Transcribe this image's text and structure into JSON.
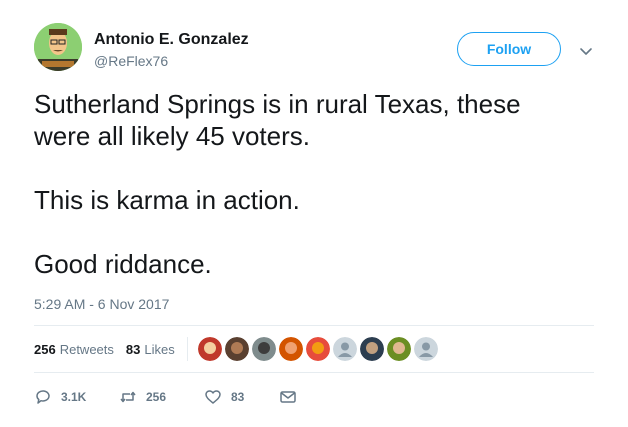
{
  "user": {
    "name": "Antonio E. Gonzalez",
    "handle": "@ReFlex76",
    "avatar_icon": "cartoon-avatar"
  },
  "header": {
    "follow_label": "Follow",
    "menu_icon": "chevron-down-icon"
  },
  "tweet": {
    "line1": "Sutherland Springs is in rural Texas, these",
    "line2": "were all likely 45 voters.",
    "line3": "This is karma in action.",
    "line4": "Good riddance.",
    "timestamp": "5:29 AM - 6 Nov 2017"
  },
  "stats": {
    "retweets_count": "256",
    "retweets_label": "Retweets",
    "likes_count": "83",
    "likes_label": "Likes"
  },
  "actions": {
    "reply_count": "3.1K",
    "retweet_count": "256",
    "like_count": "83"
  },
  "colors": {
    "accent": "#1da1f2",
    "muted": "#657786",
    "text": "#14171a",
    "divider": "#e6ecf0"
  }
}
